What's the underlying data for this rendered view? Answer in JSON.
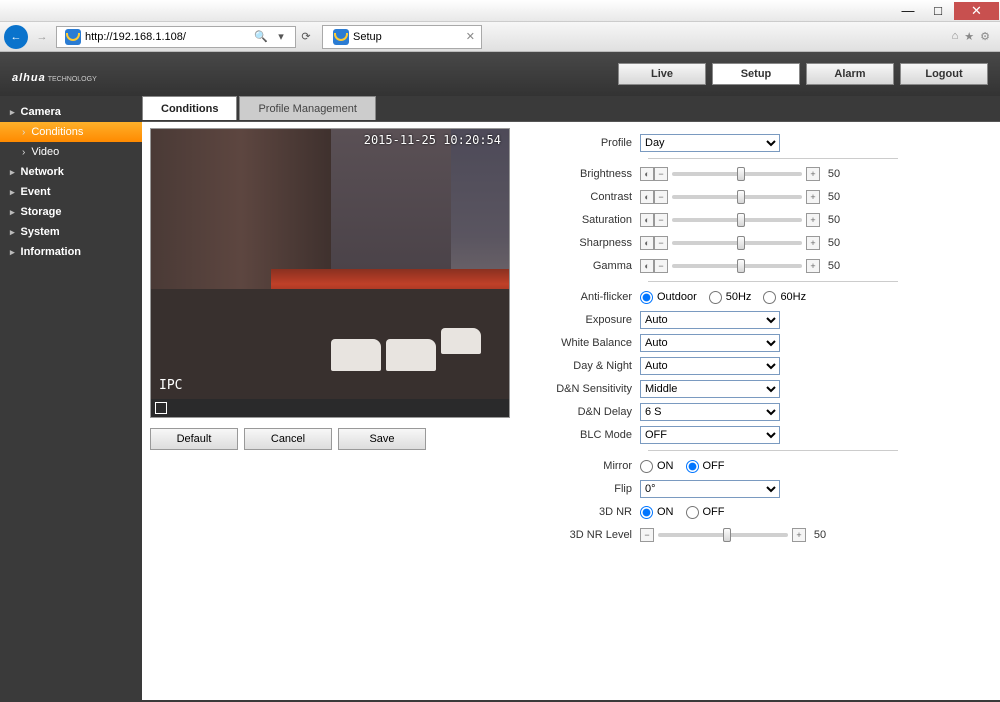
{
  "browser": {
    "url": "http://192.168.1.108/",
    "tab_title": "Setup"
  },
  "brand": "alhua",
  "brand_sub": "TECHNOLOGY",
  "topnav": [
    "Live",
    "Setup",
    "Alarm",
    "Logout"
  ],
  "topnav_active": 1,
  "sidebar": [
    {
      "label": "Camera",
      "sub": [
        {
          "label": "Conditions",
          "active": true
        },
        {
          "label": "Video"
        }
      ]
    },
    {
      "label": "Network"
    },
    {
      "label": "Event"
    },
    {
      "label": "Storage"
    },
    {
      "label": "System"
    },
    {
      "label": "Information"
    }
  ],
  "tabs": [
    {
      "label": "Conditions",
      "active": true
    },
    {
      "label": "Profile Management"
    }
  ],
  "preview": {
    "timestamp": "2015-11-25 10:20:54",
    "watermark": "IPC"
  },
  "buttons": {
    "default": "Default",
    "cancel": "Cancel",
    "save": "Save"
  },
  "settings": {
    "profile": {
      "label": "Profile",
      "value": "Day"
    },
    "sliders": [
      {
        "label": "Brightness",
        "value": 50
      },
      {
        "label": "Contrast",
        "value": 50
      },
      {
        "label": "Saturation",
        "value": 50
      },
      {
        "label": "Sharpness",
        "value": 50
      },
      {
        "label": "Gamma",
        "value": 50
      }
    ],
    "antiflicker": {
      "label": "Anti-flicker",
      "options": [
        "Outdoor",
        "50Hz",
        "60Hz"
      ],
      "selected": 0
    },
    "exposure": {
      "label": "Exposure",
      "value": "Auto"
    },
    "wb": {
      "label": "White Balance",
      "value": "Auto"
    },
    "daynight": {
      "label": "Day & Night",
      "value": "Auto"
    },
    "dnsens": {
      "label": "D&N Sensitivity",
      "value": "Middle"
    },
    "dndelay": {
      "label": "D&N Delay",
      "value": "6 S"
    },
    "blc": {
      "label": "BLC Mode",
      "value": "OFF"
    },
    "mirror": {
      "label": "Mirror",
      "options": [
        "ON",
        "OFF"
      ],
      "selected": 1
    },
    "flip": {
      "label": "Flip",
      "value": "0°"
    },
    "nr": {
      "label": "3D NR",
      "options": [
        "ON",
        "OFF"
      ],
      "selected": 0
    },
    "nrlevel": {
      "label": "3D NR Level",
      "value": 50
    }
  }
}
